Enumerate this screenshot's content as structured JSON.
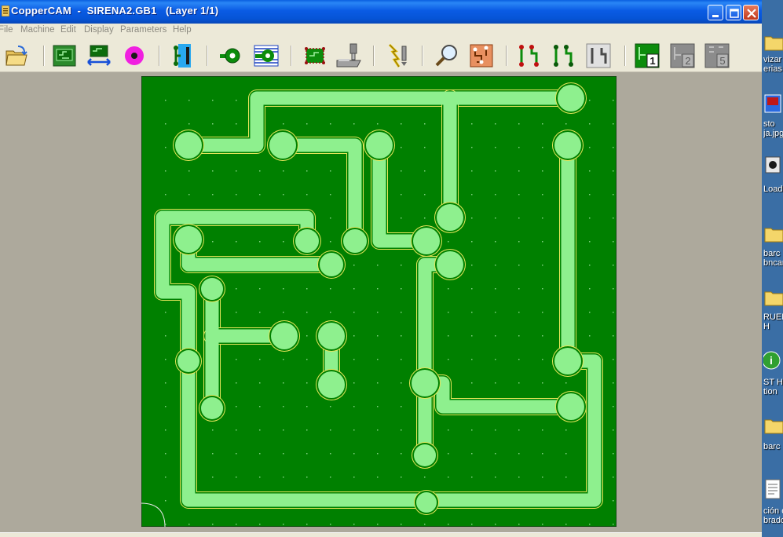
{
  "window": {
    "app_name": "CopperCAM",
    "document_title": "  -  SIRENA2.GB1   (Layer 1/1)"
  },
  "menu": [
    "File",
    "Machine",
    "Edit",
    "Display",
    "Parameters",
    "Help"
  ],
  "toolbar": {
    "items": [
      {
        "icon": "open-folder-icon"
      },
      {
        "icon": "board-icon"
      },
      {
        "icon": "board-resize-icon"
      },
      {
        "icon": "drill-point-icon"
      },
      {
        "icon": "track-icon"
      },
      {
        "icon": "single-contour-icon"
      },
      {
        "icon": "multiple-contours-icon"
      },
      {
        "icon": "card-contour-icon"
      },
      {
        "icon": "milling-tool-icon"
      },
      {
        "icon": "spark-drill-icon"
      },
      {
        "icon": "magnifier-icon"
      },
      {
        "icon": "pcb-view-icon"
      },
      {
        "icon": "route-red-icon"
      },
      {
        "icon": "route-green-icon"
      },
      {
        "icon": "route-gray-icon"
      },
      {
        "icon": "layer-1-icon",
        "label": "1"
      },
      {
        "icon": "layer-2-icon",
        "label": "2"
      },
      {
        "icon": "layer-5-icon",
        "label": "5"
      }
    ]
  },
  "colors": {
    "board": "#008000",
    "copper": "#8ef08e",
    "outline": "#e5e55a",
    "dots": "#7fcf7f",
    "workspace": "#ada99c"
  },
  "desktop_icons": [
    {
      "icon": "folder-icon",
      "label": "vizar\nerias"
    },
    {
      "icon": "image-file-icon",
      "label": "sto\nja.jpg"
    },
    {
      "icon": "loader-icon",
      "label": "Load"
    },
    {
      "icon": "folder-icon",
      "label": "barc\nbncar"
    },
    {
      "icon": "folder-icon",
      "label": "RUEN\nH"
    },
    {
      "icon": "installer-icon",
      "label": "ST Ho\ntion"
    },
    {
      "icon": "folder-icon",
      "label": "barc"
    },
    {
      "icon": "document-icon",
      "label": "ción c\nbrado"
    }
  ]
}
